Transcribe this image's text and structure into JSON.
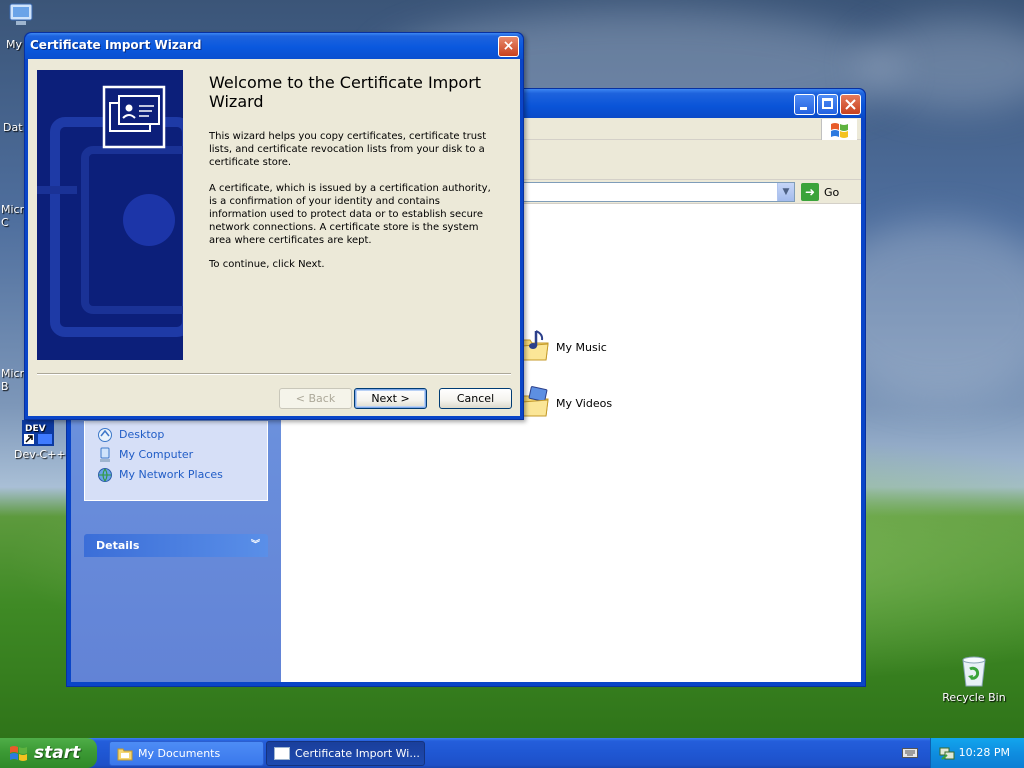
{
  "desktop": {
    "icons": [
      {
        "label": "My",
        "glyph": "my-documents-icon"
      },
      {
        "label": "Dat",
        "glyph": "database-icon"
      },
      {
        "label": "Micro C",
        "glyph": "microsoft-c-icon"
      },
      {
        "label": "Micro B",
        "glyph": "microsoft-b-icon"
      },
      {
        "label": "Dev-C++",
        "glyph": "dev-cpp-icon"
      },
      {
        "label": "Recycle Bin",
        "glyph": "recycle-bin-icon"
      }
    ]
  },
  "explorer": {
    "address_go": "Go",
    "other_places": [
      {
        "label": "Desktop",
        "icon": "desktop-icon"
      },
      {
        "label": "My Computer",
        "icon": "my-computer-icon"
      },
      {
        "label": "My Network Places",
        "icon": "network-places-icon"
      }
    ],
    "details_header": "Details",
    "folders": [
      {
        "label": "My Music",
        "icon": "music-folder-icon"
      },
      {
        "label": "My Videos",
        "icon": "video-folder-icon"
      }
    ]
  },
  "wizard": {
    "title": "Certificate Import Wizard",
    "close": "×",
    "heading": "Welcome to the Certificate Import Wizard",
    "paragraph1": "This wizard helps you copy certificates, certificate trust lists, and certificate revocation lists from your disk to a certificate store.",
    "paragraph2": "A certificate, which is issued by a certification authority, is a confirmation of your identity and contains information used to protect data or to establish secure network connections. A certificate store is the system area where certificates are kept.",
    "paragraph3": "To continue, click Next.",
    "buttons": {
      "back": "< Back",
      "next": "Next >",
      "cancel": "Cancel"
    }
  },
  "taskbar": {
    "start_label": "start",
    "tasks": [
      {
        "label": "My Documents",
        "active": false
      },
      {
        "label": "Certificate Import Wi...",
        "active": true
      }
    ],
    "clock": "10:28 PM"
  },
  "colors": {
    "xp_blue": "#0a54d8",
    "start_green": "#3c9a35",
    "tray_blue": "#0f8ee0",
    "wizard_banner": "#0c1f7a"
  }
}
